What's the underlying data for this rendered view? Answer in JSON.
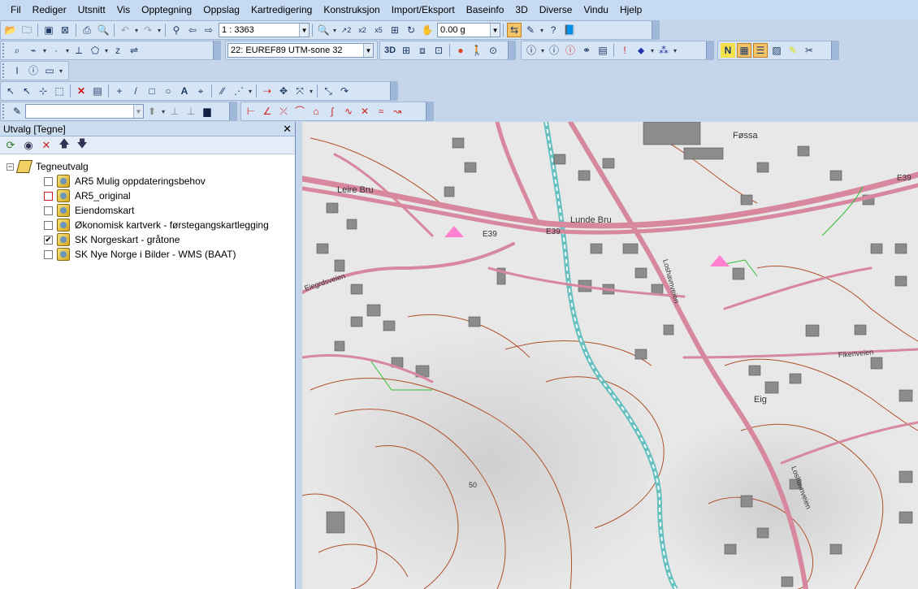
{
  "menu": [
    "Fil",
    "Rediger",
    "Utsnitt",
    "Vis",
    "Opptegning",
    "Oppslag",
    "Kartredigering",
    "Konstruksjon",
    "Import/Eksport",
    "Baseinfo",
    "3D",
    "Diverse",
    "Vindu",
    "Hjelp"
  ],
  "toolbar": {
    "scale": "1 : 3363",
    "rotation": "0.00 g",
    "projection": "22: EUREF89 UTM-sone 32",
    "btn_3d": "3D"
  },
  "panel": {
    "title": "Utvalg [Tegne]",
    "close": "✕",
    "root": "Tegneutvalg",
    "expand_symbol": "−",
    "layers": [
      {
        "name": "AR5 Mulig oppdateringsbehov",
        "checked": ""
      },
      {
        "name": "AR5_original",
        "checked": ""
      },
      {
        "name": "Eiendomskart",
        "checked": ""
      },
      {
        "name": "Økonomisk kartverk - førstegangskartlegging",
        "checked": ""
      },
      {
        "name": "SK Norgeskart - gråtone",
        "checked": "✔"
      },
      {
        "name": "SK Nye Norge i Bilder - WMS (BAAT)",
        "checked": ""
      }
    ]
  },
  "map": {
    "places": [
      "Leire Bru",
      "Lunde Bru",
      "Føssa",
      "Eig"
    ],
    "roads": [
      "E39",
      "E39",
      "E39"
    ],
    "streets": [
      "Eiegrdsveien",
      "Fikenveien",
      "Loshavnveien",
      "Loshavnveien"
    ],
    "contour": "50"
  },
  "colors": {
    "road": "#d7889e",
    "contour": "#b0502a",
    "water": "#66c0c0",
    "building": "#8c8c8c"
  }
}
